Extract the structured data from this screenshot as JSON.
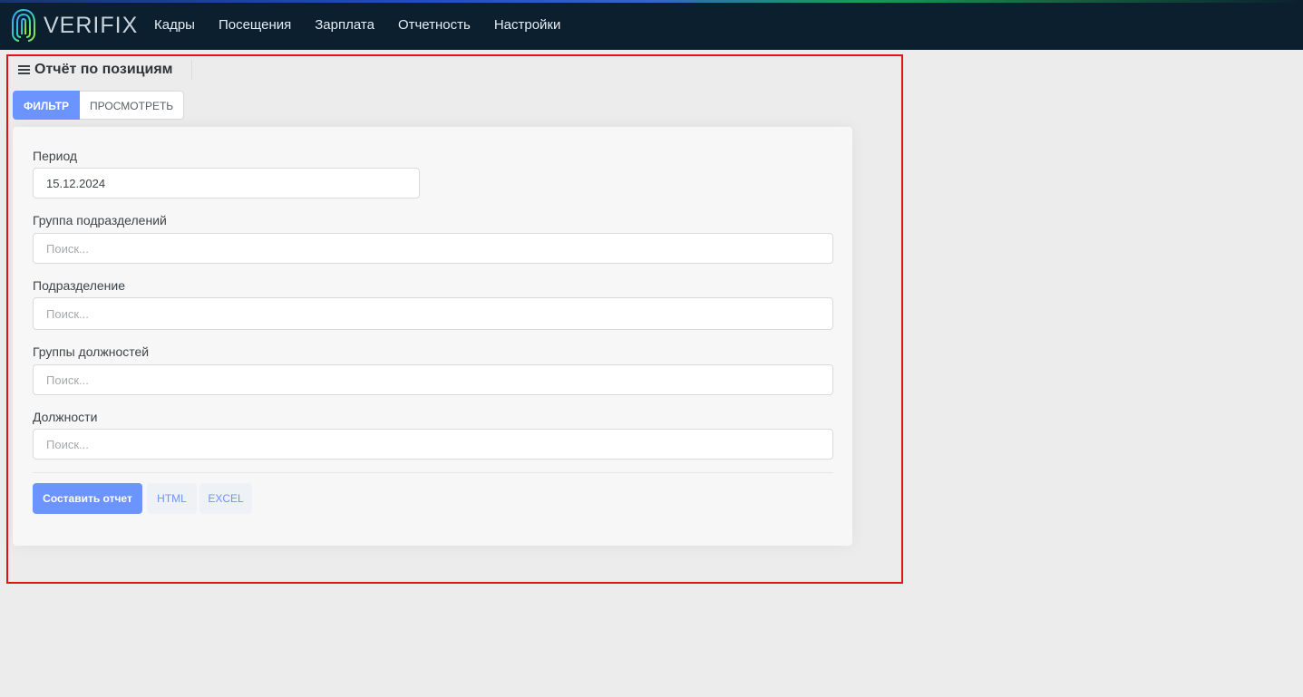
{
  "app": {
    "brand": "VERIFIX",
    "colors": {
      "navbar": "#0b1f2e",
      "primary": "#6c94ff",
      "annotation": "#e01414"
    }
  },
  "nav": {
    "items": [
      {
        "label": "Кадры"
      },
      {
        "label": "Посещения"
      },
      {
        "label": "Зарплата"
      },
      {
        "label": "Отчетность"
      },
      {
        "label": "Настройки"
      }
    ]
  },
  "page": {
    "title": "Отчёт по позициям"
  },
  "tabs": [
    {
      "label": "ФИЛЬТР",
      "active": true
    },
    {
      "label": "ПРОСМОТРЕТЬ",
      "active": false
    }
  ],
  "form": {
    "period": {
      "label": "Период",
      "value": "15.12.2024"
    },
    "division_group": {
      "label": "Группа подразделений",
      "placeholder": "Поиск..."
    },
    "division": {
      "label": "Подразделение",
      "placeholder": "Поиск..."
    },
    "job_groups": {
      "label": "Группы должностей",
      "placeholder": "Поиск..."
    },
    "jobs": {
      "label": "Должности",
      "placeholder": "Поиск..."
    }
  },
  "actions": {
    "build": "Составить отчет",
    "html": "HTML",
    "excel": "EXCEL"
  }
}
